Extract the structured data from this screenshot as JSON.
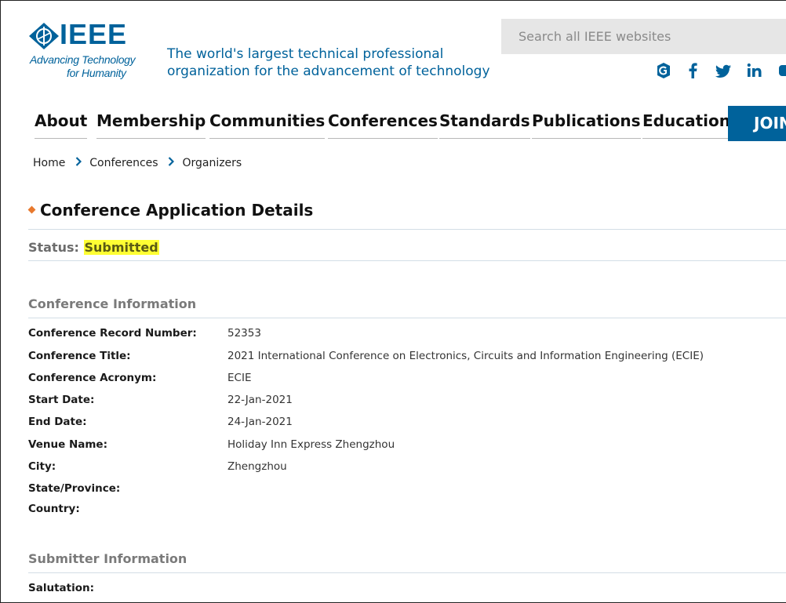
{
  "header": {
    "logo": {
      "wordmark": "IEEE",
      "tagline_line1": "Advancing Technology",
      "tagline_line2": "for Humanity"
    },
    "tagline": "The world's largest technical professional organization for the advancement of technology",
    "search": {
      "placeholder": "Search all IEEE websites",
      "value": ""
    },
    "social_icons": [
      "ieee-collabratec-icon",
      "facebook-icon",
      "twitter-icon",
      "linkedin-icon",
      "youtube-icon"
    ]
  },
  "nav": {
    "items": [
      "About",
      "Membership",
      "Communities",
      "Conferences",
      "Standards",
      "Publications",
      "Education"
    ],
    "join_label": "JOIN"
  },
  "breadcrumb": [
    "Home",
    "Conferences",
    "Organizers"
  ],
  "page": {
    "title": "Conference Application Details",
    "status_label": "Status:",
    "status_value": "Submitted"
  },
  "conference_information": {
    "heading": "Conference Information",
    "fields": [
      {
        "label": "Conference Record Number:",
        "value": "52353"
      },
      {
        "label": "Conference Title:",
        "value": "2021 International Conference on Electronics, Circuits and Information Engineering (ECIE)"
      },
      {
        "label": "Conference Acronym:",
        "value": "ECIE"
      },
      {
        "label": "Start Date:",
        "value": "22-Jan-2021"
      },
      {
        "label": "End Date:",
        "value": "24-Jan-2021"
      },
      {
        "label": "Venue Name:",
        "value": "Holiday Inn Express Zhengzhou"
      },
      {
        "label": "City:",
        "value": "Zhengzhou"
      },
      {
        "label": "State/Province:",
        "value": ""
      },
      {
        "label": "Country:",
        "value": ""
      }
    ]
  },
  "submitter_information": {
    "heading": "Submitter Information",
    "fields": [
      {
        "label": "Salutation:",
        "value": ""
      }
    ]
  },
  "colors": {
    "brand": "#00629b",
    "status_highlight": "#ffff33",
    "bullet": "#e8792e"
  }
}
